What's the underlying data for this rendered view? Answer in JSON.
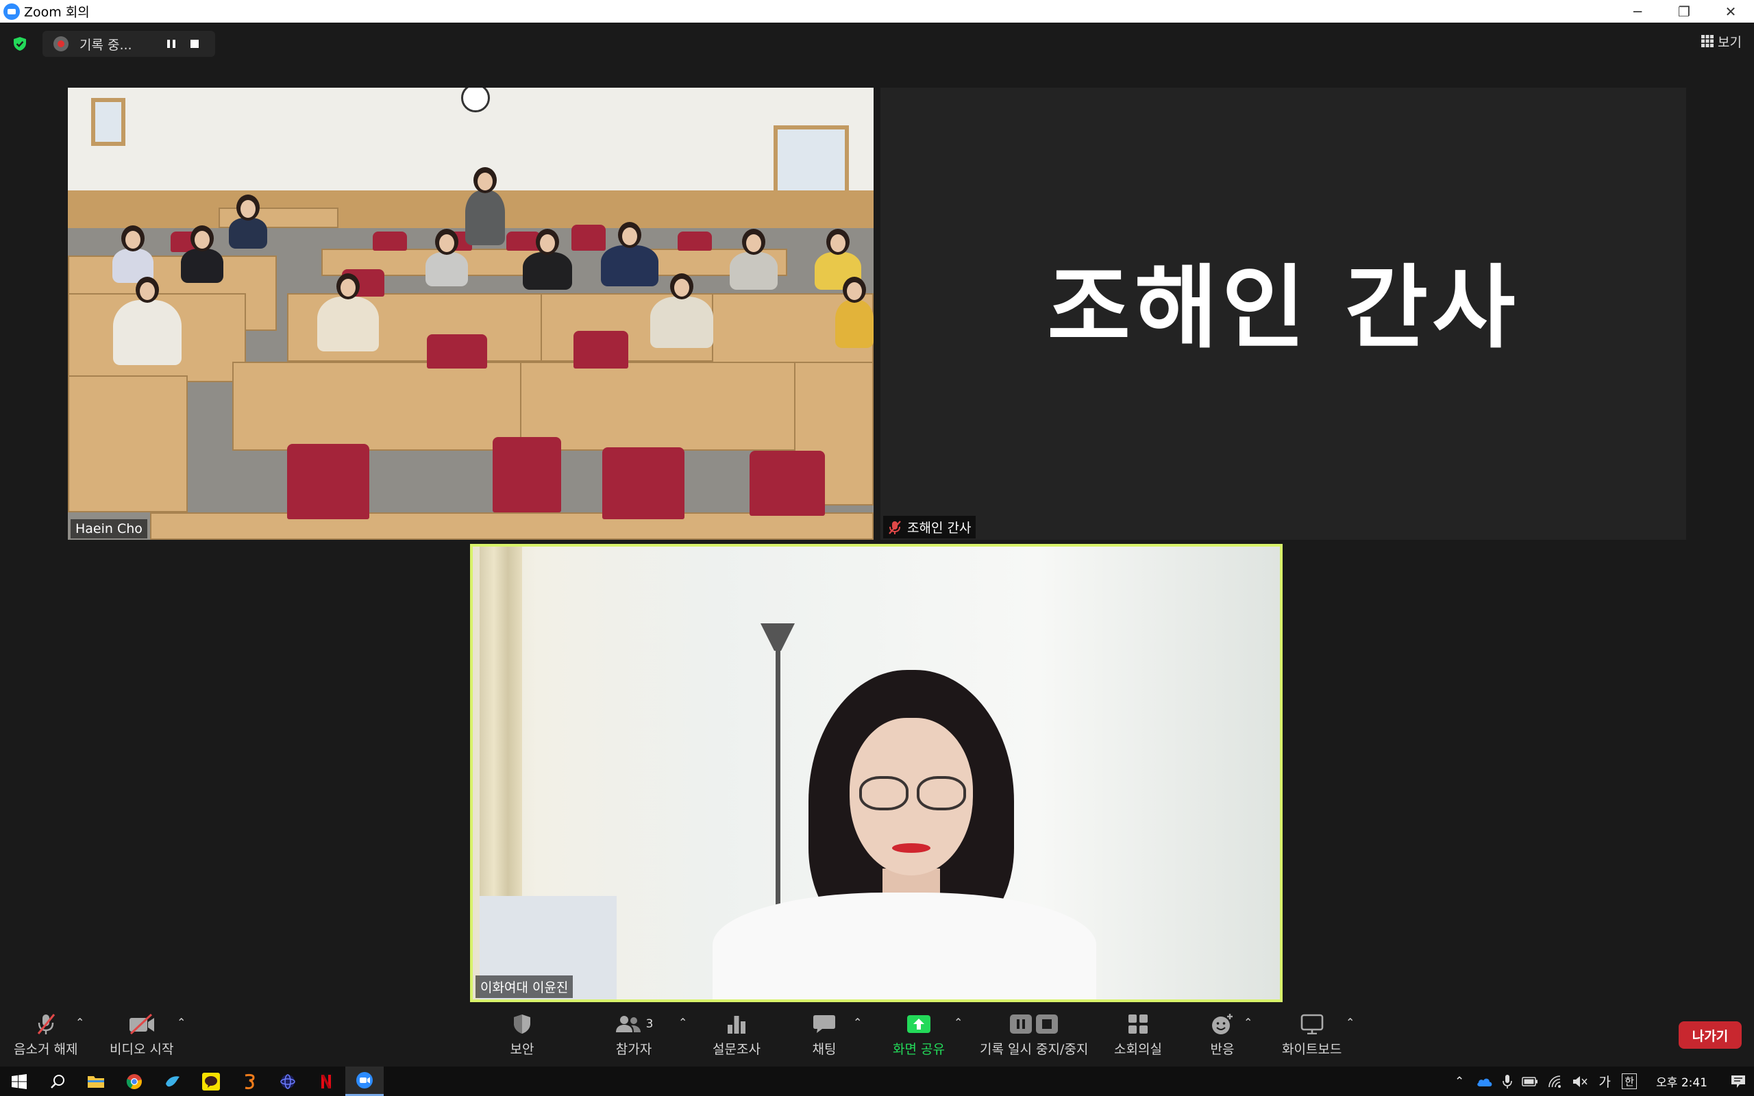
{
  "window": {
    "title": "Zoom 회의",
    "controls": [
      "─",
      "❐",
      "✕"
    ]
  },
  "topbar": {
    "recording_label": "기록 중...",
    "view_label": "보기"
  },
  "participants": {
    "classroom": {
      "name": "Haein Cho"
    },
    "name_card": {
      "name": "조해인 간사",
      "display_text": "조해인 간사"
    },
    "speaker": {
      "name": "이화여대 이윤진"
    }
  },
  "toolbar": {
    "unmute_label": "음소거 해제",
    "start_video_label": "비디오 시작",
    "security_label": "보안",
    "participants_label": "참가자",
    "participants_count": "3",
    "polls_label": "설문조사",
    "chat_label": "채팅",
    "share_label": "화면 공유",
    "record_label": "기록 일시 중지/중지",
    "breakout_label": "소회의실",
    "reactions_label": "반응",
    "whiteboard_label": "화이트보드",
    "leave_label": "나가기",
    "share_color": "#23d959",
    "leave_color": "#c8272f",
    "active_speaker_color": "#d8f26a"
  },
  "taskbar": {
    "apps": [
      "start-icon",
      "search-icon",
      "file-explorer-icon",
      "chrome-icon",
      "app-bird-icon",
      "kakaotalk-icon",
      "app-orange-icon",
      "app-globe-icon",
      "netflix-icon",
      "zoom-icon"
    ],
    "tray_ime": "가",
    "tray_ime2": "한",
    "clock": "오후 2:41"
  }
}
